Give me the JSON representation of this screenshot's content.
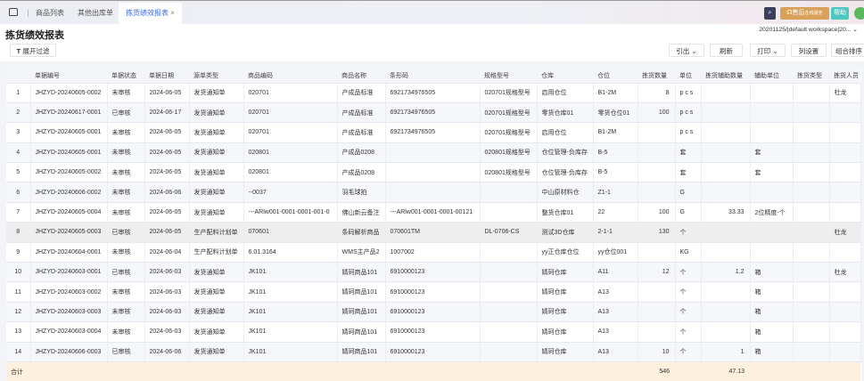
{
  "tabs": [
    {
      "label": "商品列表"
    },
    {
      "label": "其他出库单"
    },
    {
      "label": "拣货绩效报表"
    }
  ],
  "topbar": {
    "service_label": "售后",
    "service_sub": "在线服务",
    "help_label": "帮助"
  },
  "page": {
    "title": "拣货绩效报表",
    "filter_button": "展开过滤",
    "workspace": "20201125/|default workspace|20...",
    "buttons": {
      "export": "引出",
      "refresh": "刷新",
      "print": "打印",
      "columns": "列设置",
      "sort": "组合排序"
    }
  },
  "table": {
    "columns": [
      "",
      "单据编号",
      "单据状态",
      "单据日期",
      "源单类型",
      "商品编码",
      "商品名称",
      "条形码",
      "规格型号",
      "仓库",
      "仓位",
      "拣货数量",
      "单位",
      "拣货辅助数量",
      "辅助单位",
      "拣货类型",
      "拣货人员"
    ],
    "rows": [
      [
        "1",
        "JHZYD-20240605-0002",
        "未审核",
        "2024-06-05",
        "发货通知单",
        "020701",
        "产成品标准",
        "6921734976505",
        "020701规格型号",
        "启用仓位",
        "B1-2M",
        "8",
        "p c s",
        "",
        "",
        "",
        "杜龙"
      ],
      [
        "2",
        "JHZYD-20240617-0001",
        "已审核",
        "2024-06-17",
        "发货通知单",
        "020701",
        "产成品标准",
        "6921734976505",
        "020701规格型号",
        "零货仓库01",
        "零货仓位01",
        "100",
        "p c s",
        "",
        "",
        "",
        ""
      ],
      [
        "3",
        "JHZYD-20240605-0001",
        "未审核",
        "2024-06-05",
        "发货通知单",
        "020701",
        "产成品标准",
        "6921734976505",
        "020701规格型号",
        "启用仓位",
        "B1-2M",
        "",
        "p c s",
        "",
        "",
        "",
        ""
      ],
      [
        "4",
        "JHZYD-20240605-0001",
        "未审核",
        "2024-06-05",
        "发货通知单",
        "020801",
        "产成品0208",
        "",
        "020801规格型号",
        "仓位管理-负库存",
        "B-5",
        "",
        "套",
        "",
        "套",
        "",
        ""
      ],
      [
        "5",
        "JHZYD-20240605-0002",
        "未审核",
        "2024-06-05",
        "发货通知单",
        "020801",
        "产成品0208",
        "",
        "020801规格型号",
        "仓位管理-负库存",
        "B-5",
        "",
        "套",
        "",
        "套",
        "",
        ""
      ],
      [
        "6",
        "JHZYD-20240606-0002",
        "未审核",
        "2024-06-06",
        "发货通知单",
        "--0037",
        "羽毛球拍",
        "",
        "",
        "中山原材料仓",
        "Z1-1",
        "",
        "G",
        "",
        "",
        "",
        ""
      ],
      [
        "7",
        "JHZYD-20240605-0004",
        "未审核",
        "2024-06-05",
        "发货通知单",
        "---ARlw001-0001-0001-001-0",
        "佛山新云备注",
        "---ARlw001-0001-0001-00121",
        "",
        "整货仓库01",
        "22",
        "100",
        "G",
        "33.33",
        "2位精度-个",
        "",
        ""
      ],
      [
        "8",
        "JHZYD-20240605-0003",
        "已审核",
        "2024-06-05",
        "生产配料计划单",
        "070601",
        "条码解析商品",
        "070601TM",
        "DL-0706-CS",
        "测试3D仓库",
        "2-1-1",
        "130",
        "个",
        "",
        "",
        "",
        "杜龙"
      ],
      [
        "9",
        "JHZYD-20240604-0001",
        "未审核",
        "2024-06-04",
        "生产配料计划单",
        "6.01.3164",
        "WMS主产品2",
        "1007002",
        "",
        "yy正仓库仓位",
        "yy仓位001",
        "",
        "KG",
        "",
        "",
        "",
        ""
      ],
      [
        "10",
        "JHZYD-20240603-0001",
        "已审核",
        "2024-06-03",
        "发货通知单",
        "JK101",
        "婧珂商品101",
        "6910000123",
        "",
        "婧珂仓库",
        "A11",
        "12",
        "个",
        "1.2",
        "箱",
        "",
        "杜龙"
      ],
      [
        "11",
        "JHZYD-20240603-0002",
        "未审核",
        "2024-06-03",
        "发货通知单",
        "JK101",
        "婧珂商品101",
        "6910000123",
        "",
        "婧珂仓库",
        "A13",
        "",
        "个",
        "",
        "箱",
        "",
        ""
      ],
      [
        "12",
        "JHZYD-20240603-0003",
        "未审核",
        "2024-06-03",
        "发货通知单",
        "JK101",
        "婧珂商品101",
        "6910000123",
        "",
        "婧珂仓库",
        "A13",
        "",
        "个",
        "",
        "箱",
        "",
        ""
      ],
      [
        "13",
        "JHZYD-20240603-0004",
        "未审核",
        "2024-06-03",
        "发货通知单",
        "JK101",
        "婧珂商品101",
        "6910000123",
        "",
        "婧珂仓库",
        "A13",
        "",
        "个",
        "",
        "箱",
        "",
        ""
      ],
      [
        "14",
        "JHZYD-20240606-0003",
        "已审核",
        "2024-06-06",
        "发货通知单",
        "JK101",
        "婧珂商品101",
        "6910000123",
        "",
        "婧珂仓库",
        "A13",
        "10",
        "个",
        "1",
        "箱",
        "",
        ""
      ]
    ],
    "total": {
      "label": "合计",
      "qty": "546",
      "aux_qty": "47.13"
    }
  }
}
